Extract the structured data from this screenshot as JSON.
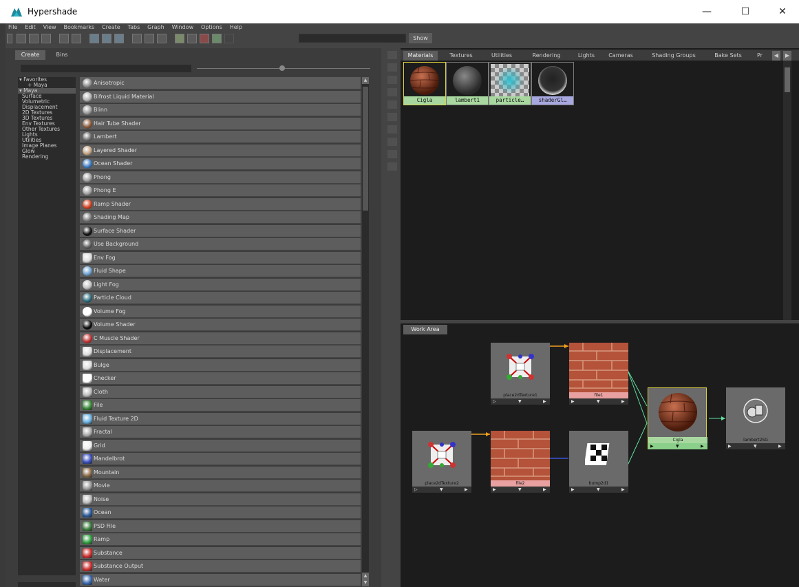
{
  "window": {
    "title": "Hypershade",
    "minimize_glyph": "—",
    "maximize_glyph": "☐",
    "close_glyph": "✕"
  },
  "menu": [
    "File",
    "Edit",
    "View",
    "Bookmarks",
    "Create",
    "Tabs",
    "Graph",
    "Window",
    "Options",
    "Help"
  ],
  "toolbar": {
    "show_label": "Show",
    "search_value": ""
  },
  "left": {
    "tabs": [
      "Create",
      "Bins"
    ],
    "search_value": "",
    "categories": [
      {
        "label": "▾ Favorites",
        "kind": "grp"
      },
      {
        "label": "+ Maya",
        "kind": "sub"
      },
      {
        "label": "▾ Maya",
        "kind": "grp",
        "selected": true
      },
      {
        "label": "Surface",
        "kind": "item"
      },
      {
        "label": "Volumetric",
        "kind": "item"
      },
      {
        "label": "Displacement",
        "kind": "item"
      },
      {
        "label": "2D Textures",
        "kind": "item"
      },
      {
        "label": "3D Textures",
        "kind": "item"
      },
      {
        "label": "Env Textures",
        "kind": "item"
      },
      {
        "label": "Other Textures",
        "kind": "item"
      },
      {
        "label": "Lights",
        "kind": "item"
      },
      {
        "label": "Utilities",
        "kind": "item"
      },
      {
        "label": "Image Planes",
        "kind": "item"
      },
      {
        "label": "Glow",
        "kind": "item"
      },
      {
        "label": "Rendering",
        "kind": "item"
      }
    ],
    "nodes": [
      {
        "label": "Anisotropic",
        "icon": "sphere-gray",
        "color": "#8a8a8a"
      },
      {
        "label": "Bifrost Liquid Material",
        "icon": "sphere-gray",
        "color": "#b0b0b0"
      },
      {
        "label": "Blinn",
        "icon": "sphere-gray",
        "color": "#9a9a9a"
      },
      {
        "label": "Hair Tube Shader",
        "icon": "hair-icon",
        "color": "#8a5a3a"
      },
      {
        "label": "Lambert",
        "icon": "sphere-dark",
        "color": "#6a6a6a"
      },
      {
        "label": "Layered Shader",
        "icon": "layered-icon",
        "color": "#c0a080"
      },
      {
        "label": "Ocean Shader",
        "icon": "ocean-icon",
        "color": "#3a7ac0"
      },
      {
        "label": "Phong",
        "icon": "sphere-gray",
        "color": "#a0a0a0"
      },
      {
        "label": "Phong E",
        "icon": "sphere-gray",
        "color": "#a0a0a0"
      },
      {
        "label": "Ramp Shader",
        "icon": "ramp-shader-icon",
        "color": "#d04020"
      },
      {
        "label": "Shading Map",
        "icon": "sphere-flat",
        "color": "#7a7a7a"
      },
      {
        "label": "Surface Shader",
        "icon": "sphere-black",
        "color": "#111111"
      },
      {
        "label": "Use Background",
        "icon": "sphere-outline",
        "color": "#5d5d5d"
      },
      {
        "label": "Env Fog",
        "icon": "env-fog-icon",
        "color": "#dddddd"
      },
      {
        "label": "Fluid Shape",
        "icon": "fluid-icon",
        "color": "#6aa0d0"
      },
      {
        "label": "Light Fog",
        "icon": "light-fog-icon",
        "color": "#c0c0c0"
      },
      {
        "label": "Particle Cloud",
        "icon": "particle-icon",
        "color": "#2a6a7a"
      },
      {
        "label": "Volume Fog",
        "icon": "volume-fog-icon",
        "color": "#ffffff"
      },
      {
        "label": "Volume Shader",
        "icon": "sphere-black",
        "color": "#0a0a0a"
      },
      {
        "label": "C Muscle Shader",
        "icon": "muscle-icon",
        "color": "#c03030"
      },
      {
        "label": "Displacement",
        "icon": "displacement-icon",
        "color": "#dddddd"
      },
      {
        "label": "Bulge",
        "icon": "bulge-icon",
        "color": "#dddddd"
      },
      {
        "label": "Checker",
        "icon": "checker-icon",
        "color": "#ffffff"
      },
      {
        "label": "Cloth",
        "icon": "cloth-icon",
        "color": "#bbbbbb"
      },
      {
        "label": "File",
        "icon": "file-icon",
        "color": "#3a8a3a"
      },
      {
        "label": "Fluid Texture 2D",
        "icon": "fluid-tex-icon",
        "color": "#6ab0e0"
      },
      {
        "label": "Fractal",
        "icon": "fractal-icon",
        "color": "#aaaaaa"
      },
      {
        "label": "Grid",
        "icon": "grid-icon",
        "color": "#eeeeee"
      },
      {
        "label": "Mandelbrot",
        "icon": "mandelbrot-icon",
        "color": "#3a50c0"
      },
      {
        "label": "Mountain",
        "icon": "mountain-icon",
        "color": "#8a6a4a"
      },
      {
        "label": "Movie",
        "icon": "movie-icon",
        "color": "#999999"
      },
      {
        "label": "Noise",
        "icon": "noise-icon",
        "color": "#bbbbbb"
      },
      {
        "label": "Ocean",
        "icon": "ocean-tex-icon",
        "color": "#2a5a9a"
      },
      {
        "label": "PSD File",
        "icon": "psd-icon",
        "color": "#3a7a3a"
      },
      {
        "label": "Ramp",
        "icon": "ramp-icon",
        "color": "#30a040"
      },
      {
        "label": "Substance",
        "icon": "substance-icon",
        "color": "#d03030"
      },
      {
        "label": "Substance Output",
        "icon": "substance-output-icon",
        "color": "#d03030"
      },
      {
        "label": "Water",
        "icon": "water-icon",
        "color": "#3a6ab0"
      }
    ]
  },
  "browser": {
    "tabs": [
      "Materials",
      "Textures",
      "Utilities",
      "Rendering",
      "Lights",
      "Cameras",
      "Shading Groups",
      "Bake Sets",
      "Pr"
    ],
    "active_tab": "Materials",
    "swatches": [
      {
        "caption": "Cigla",
        "kind": "brick-sphere",
        "caption_color": "#a8d8a0",
        "border": "#d8d040"
      },
      {
        "caption": "lambert1",
        "kind": "gray-sphere",
        "caption_color": "#a8d8a0",
        "border": "#777777"
      },
      {
        "caption": "particle…",
        "kind": "particle",
        "caption_color": "#a8d8a0",
        "border": "#777777"
      },
      {
        "caption": "shaderGl…",
        "kind": "glow-sphere",
        "caption_color": "#a8a8e0",
        "border": "#777777"
      }
    ]
  },
  "workarea": {
    "tab": "Work Area",
    "nodes": [
      {
        "name": "place2dTexture1",
        "kind": "place2d",
        "label_bg": "#6a6a6a"
      },
      {
        "name": "file1",
        "kind": "brick",
        "label_bg": "#e8a0a0"
      },
      {
        "name": "place2dTexture2",
        "kind": "place2d",
        "label_bg": "#6a6a6a"
      },
      {
        "name": "file2",
        "kind": "brick",
        "label_bg": "#e8a0a0"
      },
      {
        "name": "bump2d1",
        "kind": "bump",
        "label_bg": "#6a6a6a"
      },
      {
        "name": "Cigla",
        "kind": "brick-sphere",
        "label_bg": "#a8d8a0"
      },
      {
        "name": "lambert2SG",
        "kind": "sg",
        "label_bg": "#6a6a6a"
      }
    ]
  },
  "colors": {
    "wire_place": "#f0a020",
    "wire_color": "#60e0a0",
    "wire_bump": "#4060ff"
  }
}
